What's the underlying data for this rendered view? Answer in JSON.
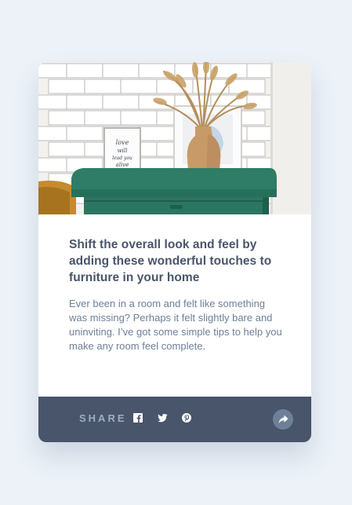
{
  "article": {
    "image_alt": "Green drawers with a vase of dried grass and framed prints",
    "frame_text": "love will lead you alive",
    "title": "Shift the overall look and feel by adding these wonderful touches to furniture in your home",
    "excerpt": "Ever been in a room and felt like something was missing? Perhaps it felt slightly bare and uninviting. I’ve got some simple tips to help you make any room feel complete."
  },
  "footer": {
    "share_label": "SHARE",
    "social_icons": [
      "facebook-icon",
      "twitter-icon",
      "pinterest-icon"
    ],
    "share_button_icon": "share-arrow-icon"
  },
  "colors": {
    "page_background": "#ecf2f8",
    "card_background": "#ffffff",
    "title": "#48556a",
    "excerpt": "#6e8098",
    "footer_background": "#48556a",
    "share_label": "#9eafc2",
    "share_button": "#6e8098"
  }
}
